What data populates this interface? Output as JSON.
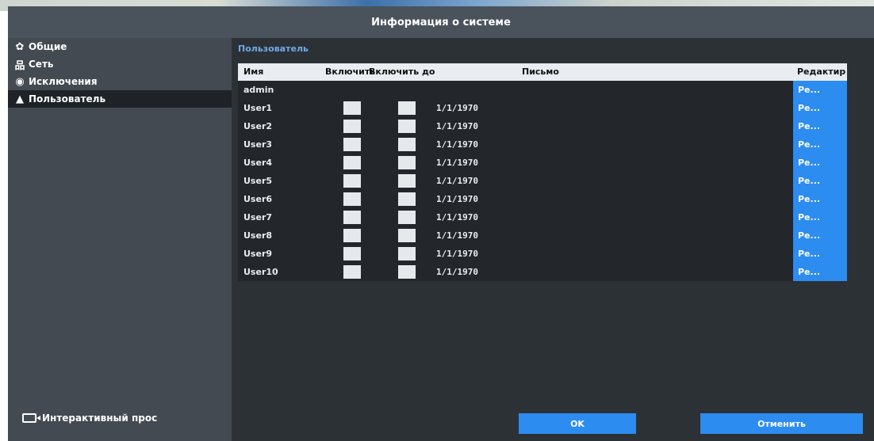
{
  "window": {
    "title": "Информация о системе"
  },
  "sidebar": {
    "items": [
      {
        "label": "Общие",
        "icon": "gear-icon",
        "glyph": "✿"
      },
      {
        "label": "Сеть",
        "icon": "network-icon",
        "glyph": "品"
      },
      {
        "label": "Исключения",
        "icon": "eye-icon",
        "glyph": "◉"
      },
      {
        "label": "Пользователь",
        "icon": "warning-icon",
        "glyph": "▲"
      }
    ],
    "active_index": 3,
    "live_view_label": "Интерактивный прос"
  },
  "main": {
    "section_title": "Пользователь",
    "table": {
      "headers": {
        "name": "Имя",
        "enable": "Включить",
        "enable_until": "Включить до",
        "email": "Письмо",
        "edit": "Редактир"
      },
      "rows": [
        {
          "name": "admin",
          "date": "",
          "edit": "Pe..."
        },
        {
          "name": "User1",
          "date": "1/1/1970",
          "edit": "Pe..."
        },
        {
          "name": "User2",
          "date": "1/1/1970",
          "edit": "Pe..."
        },
        {
          "name": "User3",
          "date": "1/1/1970",
          "edit": "Pe..."
        },
        {
          "name": "User4",
          "date": "1/1/1970",
          "edit": "Pe..."
        },
        {
          "name": "User5",
          "date": "1/1/1970",
          "edit": "Pe..."
        },
        {
          "name": "User6",
          "date": "1/1/1970",
          "edit": "Pe..."
        },
        {
          "name": "User7",
          "date": "1/1/1970",
          "edit": "Pe..."
        },
        {
          "name": "User8",
          "date": "1/1/1970",
          "edit": "Pe..."
        },
        {
          "name": "User9",
          "date": "1/1/1970",
          "edit": "Pe..."
        },
        {
          "name": "User10",
          "date": "1/1/1970",
          "edit": "Pe..."
        }
      ]
    }
  },
  "footer": {
    "ok_label": "OK",
    "cancel_label": "Отменить"
  },
  "colors": {
    "accent": "#2c8cf0",
    "section_title": "#6ea9e8",
    "header_bg": "#e9edf2",
    "panel_bg": "#2c3136",
    "sidebar_bg": "#444a51",
    "titlebar_bg": "#4a525b"
  }
}
